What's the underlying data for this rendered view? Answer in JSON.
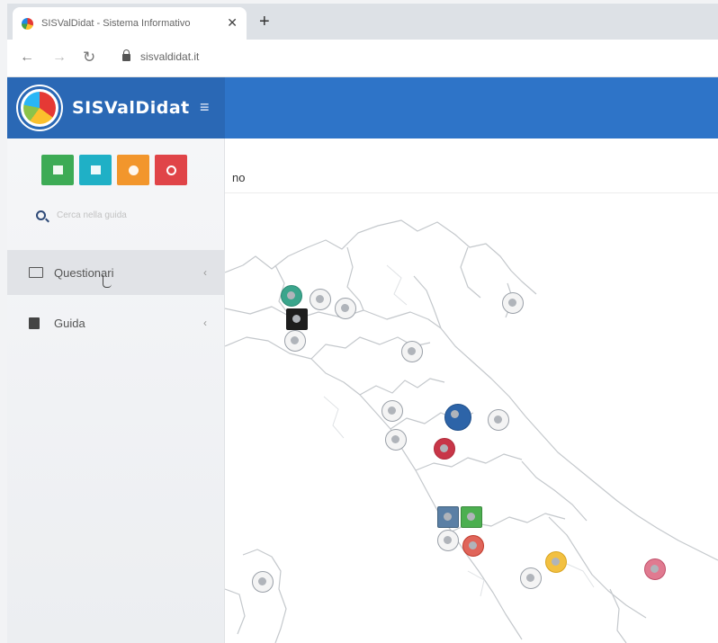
{
  "browser": {
    "tab_title": "SISValDidat - Sistema Informativo",
    "url": "sisvaldidat.it",
    "icons": {
      "back": "back-arrow-icon",
      "forward": "forward-arrow-icon",
      "reload": "reload-icon",
      "close": "close-icon",
      "new_tab": "plus-icon",
      "lock": "lock-icon"
    }
  },
  "header": {
    "brand_name": "SISValDidat",
    "menu_icon": "hamburger-icon",
    "color": "#2e74c8"
  },
  "sidebar": {
    "quick_actions": [
      {
        "icon": "bank-icon",
        "color": "#3dab55"
      },
      {
        "icon": "monitor-icon",
        "color": "#1fb0c6"
      },
      {
        "icon": "info-icon",
        "color": "#f2962c"
      },
      {
        "icon": "power-icon",
        "color": "#e04448"
      }
    ],
    "search_placeholder": "Cerca nella guida",
    "items": [
      {
        "label": "Questionari",
        "icon": "keyboard-icon",
        "chevron": "‹"
      },
      {
        "label": "Guida",
        "icon": "book-icon",
        "chevron": "‹"
      }
    ]
  },
  "content": {
    "title": "no"
  }
}
